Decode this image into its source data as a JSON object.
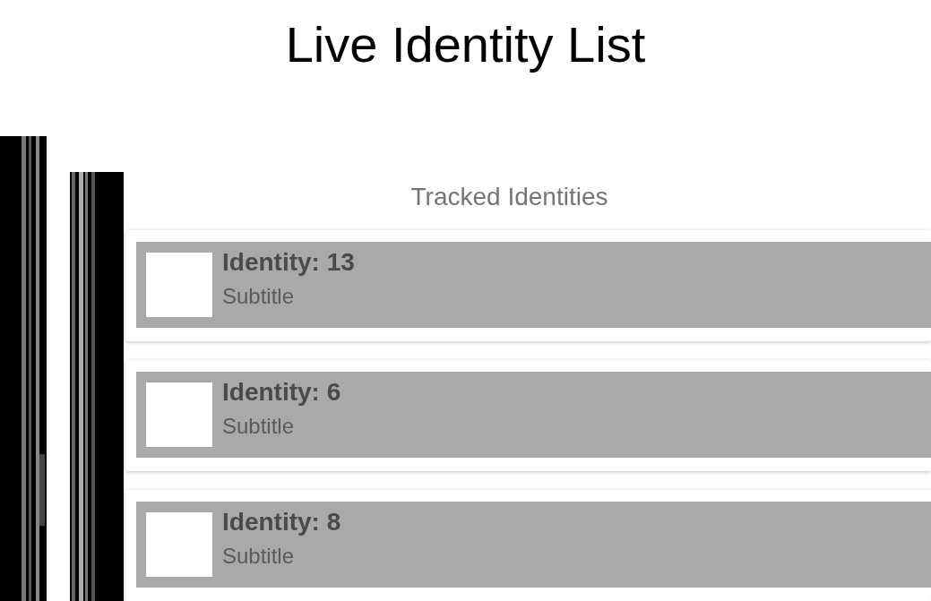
{
  "title": "Live Identity List",
  "screen": {
    "header": "Tracked Identities",
    "items": [
      {
        "title": "Identity: 13",
        "subtitle": "Subtitle"
      },
      {
        "title": "Identity: 6",
        "subtitle": "Subtitle"
      },
      {
        "title": "Identity: 8",
        "subtitle": "Subtitle"
      }
    ]
  }
}
